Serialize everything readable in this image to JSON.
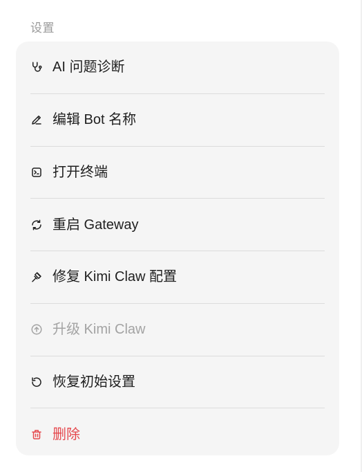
{
  "section": {
    "title": "设置"
  },
  "menu": {
    "items": [
      {
        "label": "AI 问题诊断",
        "icon": "stethoscope-icon",
        "state": "normal"
      },
      {
        "label": "编辑 Bot 名称",
        "icon": "pencil-icon",
        "state": "normal"
      },
      {
        "label": "打开终端",
        "icon": "terminal-icon",
        "state": "normal"
      },
      {
        "label": "重启 Gateway",
        "icon": "refresh-icon",
        "state": "normal"
      },
      {
        "label": "修复 Kimi Claw 配置",
        "icon": "hammer-icon",
        "state": "normal"
      },
      {
        "label": "升级 Kimi Claw",
        "icon": "upgrade-circle-icon",
        "state": "disabled"
      },
      {
        "label": "恢复初始设置",
        "icon": "rotate-ccw-icon",
        "state": "normal"
      },
      {
        "label": "删除",
        "icon": "trash-icon",
        "state": "danger"
      }
    ]
  },
  "colors": {
    "text": "#1f1f1f",
    "muted": "#a3a3a3",
    "danger": "#e5484d",
    "card": "#f5f5f5",
    "divider": "#dcdcdc"
  }
}
